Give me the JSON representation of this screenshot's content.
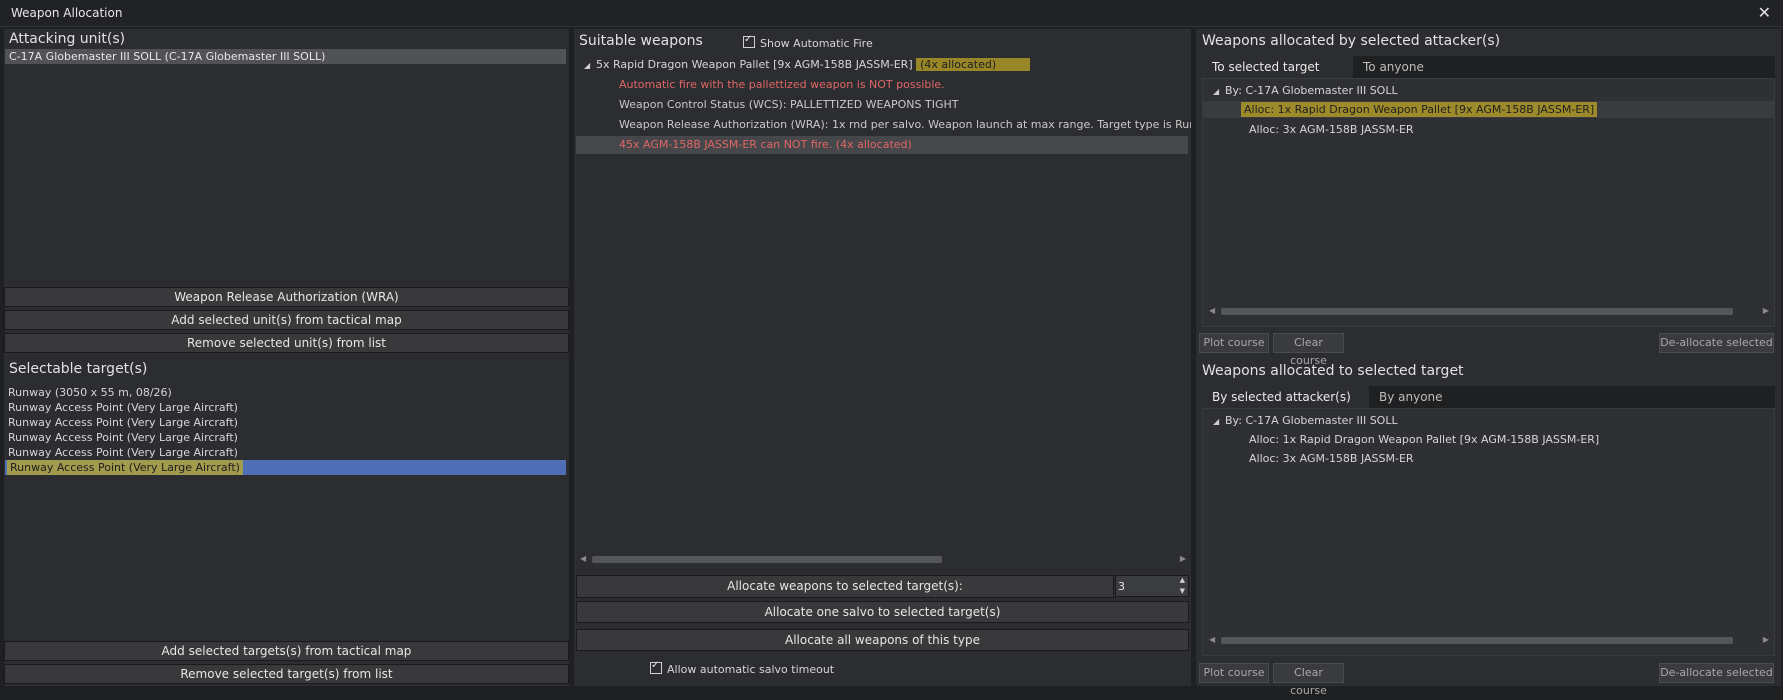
{
  "window": {
    "title": "Weapon Allocation",
    "close_glyph": "✕"
  },
  "left": {
    "attacking_heading": "Attacking unit(s)",
    "attacking_units": [
      "C-17A Globemaster III SOLL (C-17A Globemaster III SOLL)"
    ],
    "buttons": {
      "wra": "Weapon Release Authorization (WRA)",
      "add_units": "Add selected unit(s) from tactical map",
      "remove_units": "Remove selected unit(s) from list"
    },
    "targets_heading": "Selectable target(s)",
    "targets": [
      "Runway (3050 x 55 m, 08/26)",
      "Runway Access Point (Very Large Aircraft)",
      "Runway Access Point (Very Large Aircraft)",
      "Runway Access Point (Very Large Aircraft)",
      "Runway Access Point (Very Large Aircraft)",
      "Runway Access Point (Very Large Aircraft)"
    ],
    "selected_target_index": 5,
    "target_buttons": {
      "add": "Add selected targets(s) from tactical map",
      "remove": "Remove selected target(s) from list"
    }
  },
  "middle": {
    "heading": "Suitable weapons",
    "show_auto_fire_label": "Show Automatic Fire",
    "show_auto_fire_checked": true,
    "weapon_group": {
      "name": "5x Rapid Dragon Weapon Pallet [9x AGM-158B JASSM-ER]",
      "allocated": "(4x allocated)"
    },
    "weapon_lines": [
      {
        "text": "Automatic fire with the pallettized weapon is NOT possible.",
        "style": "red"
      },
      {
        "text": "Weapon Control Status (WCS):  PALLETTIZED WEAPONS TIGHT",
        "style": "normal"
      },
      {
        "text": "Weapon Release Authorization (WRA): 1x rnd per salvo. Weapon launch at max range.  Target type is Runw",
        "style": "normal"
      },
      {
        "text": "45x AGM-158B JASSM-ER can NOT fire.  (4x allocated)",
        "style": "red-selected"
      }
    ],
    "allocate_label": "Allocate weapons to selected target(s):",
    "allocate_quantity": "3",
    "allocate_salvo_label": "Allocate one salvo to selected target(s)",
    "allocate_all_label": "Allocate all weapons of this type",
    "auto_salvo_label": "Allow automatic salvo timeout",
    "auto_salvo_checked": true
  },
  "right": {
    "top": {
      "heading": "Weapons allocated by selected attacker(s)",
      "tabs": [
        "To selected target only",
        "To anyone"
      ],
      "active_tab": 0,
      "group": "By: C-17A Globemaster III SOLL",
      "items": [
        "Alloc:  1x Rapid Dragon Weapon Pallet [9x AGM-158B JASSM-ER]",
        "Alloc:  3x AGM-158B JASSM-ER"
      ],
      "highlighted_item": 0,
      "buttons": {
        "plot": "Plot course",
        "clear": "Clear course",
        "deallocate": "De-allocate selected"
      }
    },
    "bottom": {
      "heading": "Weapons allocated to selected target",
      "tabs": [
        "By selected attacker(s) only",
        "By anyone"
      ],
      "active_tab": 0,
      "group": "By: C-17A Globemaster III SOLL",
      "items": [
        "Alloc: 1x Rapid Dragon Weapon Pallet [9x AGM-158B JASSM-ER]",
        "Alloc: 3x AGM-158B JASSM-ER"
      ],
      "buttons": {
        "plot": "Plot course",
        "clear": "Clear course",
        "deallocate": "De-allocate selected"
      }
    }
  },
  "colors": {
    "background": "#1f2022",
    "panel": "#2c2d30",
    "selection_blue": "#4e6fb5",
    "highlight_yellow": "#c4aa24",
    "error_red": "#e06666"
  }
}
